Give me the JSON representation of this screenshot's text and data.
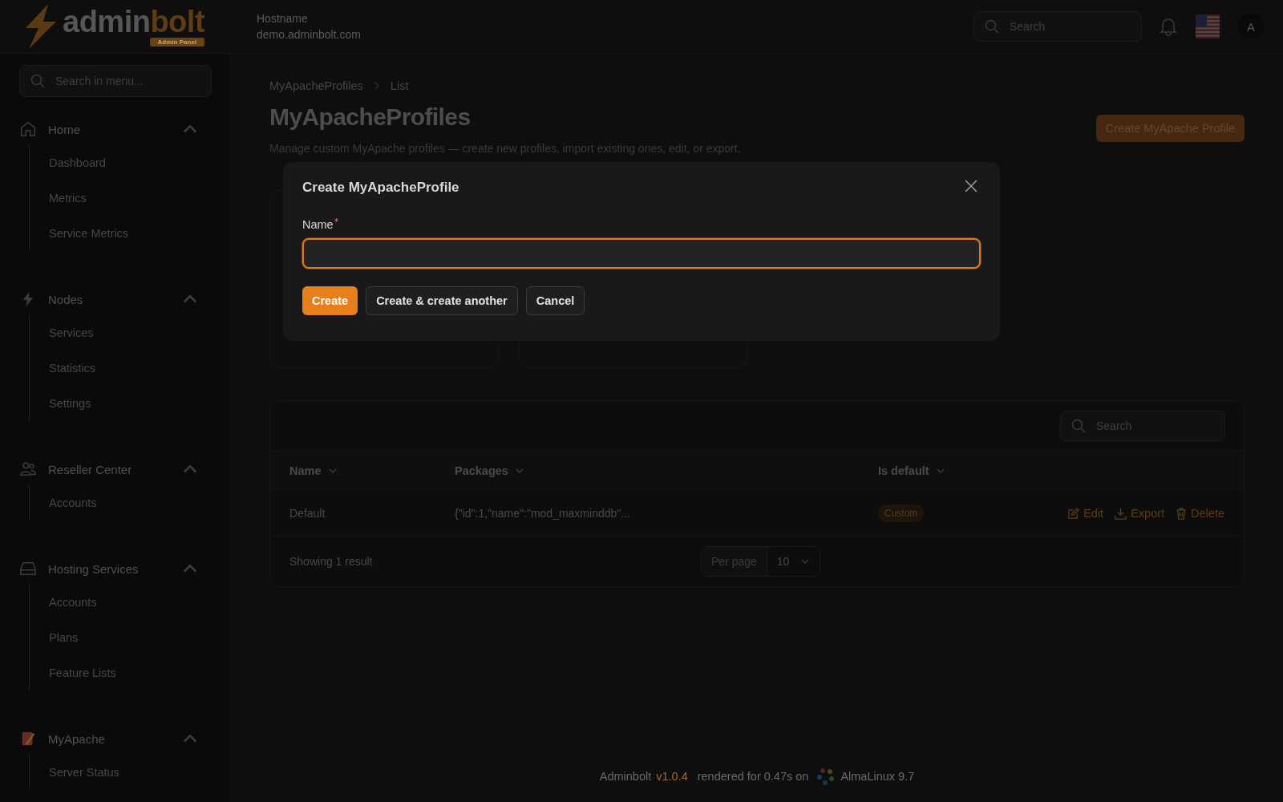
{
  "header": {
    "logo": {
      "left": "admin",
      "right": "bolt",
      "badge": "Admin Panel"
    },
    "hostname_label": "Hostname",
    "hostname": "demo.adminbolt.com",
    "search": {
      "placeholder": "Search"
    },
    "avatar": "A"
  },
  "sidebar": {
    "search": {
      "placeholder": "Search in menu..."
    },
    "groups": [
      {
        "label": "Home",
        "expanded": true,
        "items": [
          "Dashboard",
          "Metrics",
          "Service Metrics"
        ]
      },
      {
        "label": "Nodes",
        "expanded": true,
        "items": [
          "Services",
          "Statistics",
          "Settings"
        ]
      },
      {
        "label": "Reseller Center",
        "expanded": true,
        "items": [
          "Accounts"
        ]
      },
      {
        "label": "Hosting Services",
        "expanded": true,
        "items": [
          "Accounts",
          "Plans",
          "Feature Lists"
        ]
      },
      {
        "label": "MyApache",
        "expanded": true,
        "items": [
          "Server Status"
        ]
      }
    ]
  },
  "breadcrumbs": [
    "MyApacheProfiles",
    "List"
  ],
  "page_title": "MyApacheProfiles",
  "description": "Manage custom MyApache profiles — create new profiles, import existing ones, edit, or export.",
  "create_button": "Create MyApache Profile",
  "table": {
    "search": {
      "placeholder": "Search"
    },
    "columns": [
      "Name",
      "Packages",
      "Is default"
    ],
    "rows": [
      {
        "name": "Default",
        "packages": "{\"id\":1,\"name\":\"mod_maxminddb\"...",
        "badge": "Custom",
        "actions": [
          "Edit",
          "Export",
          "Delete"
        ]
      }
    ],
    "summary": "Showing 1 result",
    "per_page_label": "Per page",
    "per_page": "10"
  },
  "footer": {
    "app": "Adminbolt",
    "version": "v1.0.4",
    "text": "rendered for 0.47s on",
    "os": "AlmaLinux 9.7"
  },
  "modal": {
    "title": "Create MyApacheProfile",
    "field": {
      "label": "Name",
      "required": true,
      "focused": true
    },
    "buttons": [
      {
        "label": "Create",
        "kind": "primary"
      },
      {
        "label": "Create & create another",
        "kind": "secondary"
      },
      {
        "label": "Cancel",
        "kind": "secondary"
      }
    ]
  }
}
